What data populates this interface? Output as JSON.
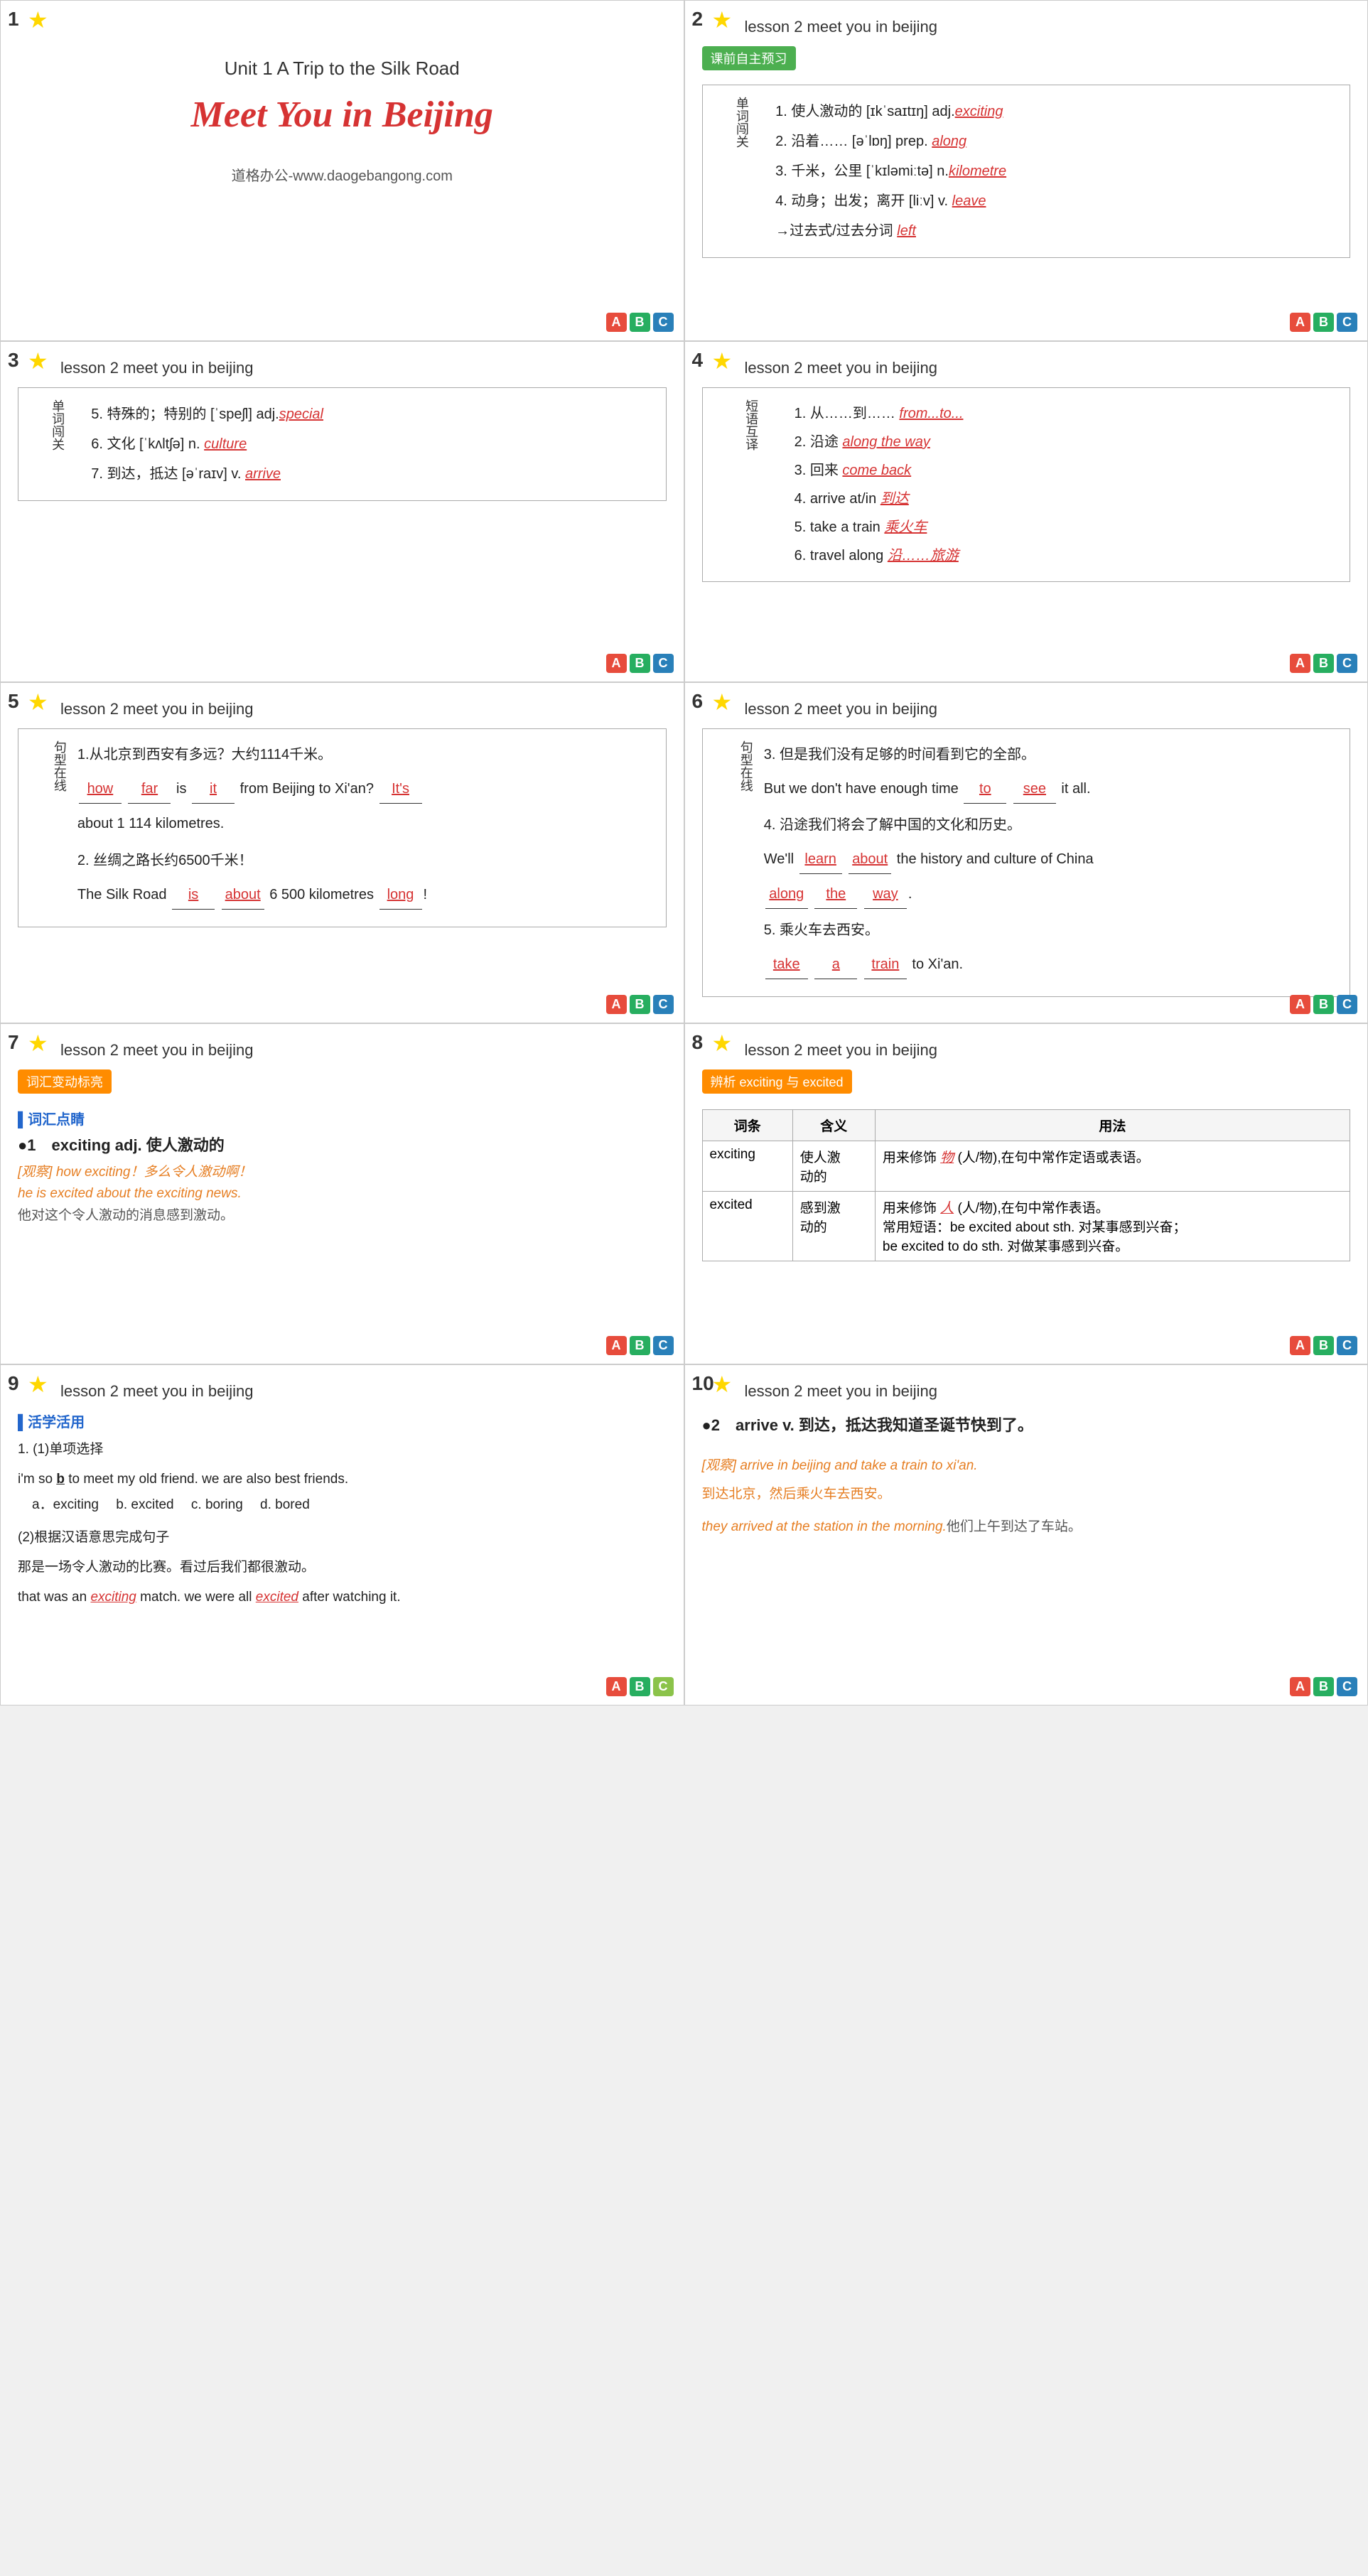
{
  "cells": [
    {
      "number": "1",
      "type": "title",
      "unit": "Unit 1  A Trip to the Silk Road",
      "main_title": "Meet You in Beijing",
      "website": "道格办公-www.daogebangong.com"
    },
    {
      "number": "2",
      "lesson": "lesson 2   meet you in beijing",
      "tag": "课前自主预习",
      "tag_color": "green",
      "section_label": "单词闯关",
      "vocab": [
        {
          "num": "1",
          "text": "使人激动的 [ɪkˈsaɪtɪŋ] adj.",
          "answer": "exciting",
          "extra": ""
        },
        {
          "num": "2",
          "text": "沿着…… [əˈlɒŋ] prep.",
          "answer": "along",
          "extra": ""
        },
        {
          "num": "3",
          "text": "千米，公里 [ˈkɪləmiːtə] n.",
          "answer": "kilometre",
          "extra": ""
        },
        {
          "num": "4",
          "text": "动身；出发；离开 [liːv] v.",
          "answer": "leave",
          "extra": "→过去式/过去分词 left"
        }
      ]
    },
    {
      "number": "3",
      "lesson": "lesson 2   meet you in beijing",
      "section_label": "单词闯关",
      "vocab": [
        {
          "num": "5",
          "text": "特殊的；特别的 [ˈspeʃl] adj.",
          "answer": "special"
        },
        {
          "num": "6",
          "text": "文化 [ˈkʌltʃə] n.",
          "answer": "culture"
        },
        {
          "num": "7",
          "text": "到达，抵达 [əˈraɪv] v.",
          "answer": "arrive"
        }
      ]
    },
    {
      "number": "4",
      "lesson": "lesson 2   meet you in beijing",
      "section_label": "短语互译",
      "phrases": [
        {
          "num": "1",
          "text": "从……到……",
          "answer": "from...to..."
        },
        {
          "num": "2",
          "text": "沿途",
          "answer": "along the way"
        },
        {
          "num": "3",
          "text": "回来",
          "answer": "come back"
        },
        {
          "num": "4",
          "text": "arrive at/in",
          "answer": "到达"
        },
        {
          "num": "5",
          "text": "take a train",
          "answer": "乘火车"
        },
        {
          "num": "6",
          "text": "travel along",
          "answer": "沿……旅游"
        }
      ]
    },
    {
      "number": "5",
      "lesson": "lesson 2   meet you in beijing",
      "section_label": "句型在线",
      "sentences": [
        {
          "num": "1",
          "chinese": "从北京到西安有多远？大约1114千米。",
          "template": "_____ _____ is _____ from Beijing to Xi'an?  _____",
          "answers": [
            "how",
            "far",
            "it",
            "It's"
          ],
          "extra": "about 1 114 kilometres."
        },
        {
          "num": "2",
          "chinese": "丝绸之路长约6500千米！",
          "template": "The Silk Road _____ _____ 6 500 kilometres _____!",
          "answers": [
            "is",
            "about",
            "long"
          ]
        }
      ]
    },
    {
      "number": "6",
      "lesson": "lesson 2   meet you in beijing",
      "section_label": "句型在线",
      "sentences": [
        {
          "num": "3",
          "chinese": "但是我们没有足够的时间看到它的全部。",
          "english": "But we don't have enough time _____ _____ it all.",
          "answers": [
            "to",
            "see"
          ]
        },
        {
          "num": "4",
          "chinese": "沿途我们将会了解中国的文化和历史。",
          "english": "We'll _____ _____ the history and culture of China _____ _____ _____.",
          "answers": [
            "learn",
            "about",
            "along",
            "the",
            "way"
          ]
        },
        {
          "num": "5",
          "chinese": "乘火车去西安。",
          "english": "_____ _____ _____ _____ to Xi'an.",
          "answers": [
            "take",
            "a",
            "train"
          ]
        }
      ]
    },
    {
      "number": "7",
      "lesson": "lesson 2   meet you in beijing",
      "tag": "词汇变动标亮",
      "section_header": "词汇点睛",
      "bullet": "1",
      "word": "exciting adj. 使人激动的",
      "observe": "[观察] how exciting！多么令人激动啊！",
      "example1": "he is excited about the exciting news.",
      "example2": "他对这个令人激动的消息感到激动。"
    },
    {
      "number": "8",
      "lesson": "lesson 2   meet you in beijing",
      "tag": "辨析 exciting 与 excited",
      "table": {
        "headers": [
          "词条",
          "含义",
          "用法"
        ],
        "rows": [
          {
            "word": "exciting",
            "meaning": "使人激动的",
            "usage": "用来修饰  物  (人/物),在句中常作定语或表语。"
          },
          {
            "word": "excited",
            "meaning": "感到激动的",
            "usage": "用来修饰  人  (人/物),在句中常作表语。\n常用短语：be excited about sth. 对某事感到兴奋；\nbe excited to do sth. 对做某事感到兴奋。"
          }
        ]
      }
    },
    {
      "number": "9",
      "lesson": "lesson 2   meet you in beijing",
      "tag": "活学活用",
      "practice": {
        "title": "1. (1)单项选择",
        "question": "i'm so _b_ to meet my old friend. we are also best friends.",
        "answer_letter": "b",
        "options": [
          {
            "letter": "a",
            "text": "exciting"
          },
          {
            "letter": "b",
            "text": "excited"
          },
          {
            "letter": "c",
            "text": "boring"
          },
          {
            "letter": "d",
            "text": "bored"
          }
        ],
        "title2": "(2)根据汉语意思完成句子",
        "chinese2": "那是一场令人激动的比赛。看过后我们都很激动。",
        "english2_1": "that was an",
        "blank2_1": "exciting",
        "english2_2": "match. we were all",
        "blank2_2": "excited",
        "english2_3": "after watching it."
      }
    },
    {
      "number": "10",
      "lesson": "lesson 2   meet you in beijing",
      "bullet": "2",
      "word": "arrive v. 到达，抵达我知道圣诞节快到了。",
      "observe_label": "[观察]",
      "example_en1": "arrive in beijing and take a train to xi'an.",
      "example_zh1": "到达北京，然后乘火车去西安。",
      "example_en2": "they arrived at the station in the morning.",
      "example_zh2": "他们上午到达了车站。"
    }
  ],
  "abc_labels": {
    "a": "A",
    "b": "B",
    "c": "C"
  }
}
